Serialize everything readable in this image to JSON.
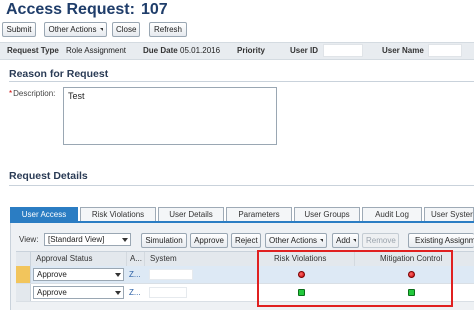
{
  "page": {
    "title_prefix": "Access Request:",
    "title_number": "107"
  },
  "toolbar": {
    "submit_label": "Submit",
    "other_actions_label": "Other Actions",
    "close_label": "Close",
    "refresh_label": "Refresh"
  },
  "header": {
    "request_type_label": "Request Type",
    "request_type_value": "Role Assignment",
    "due_date_label": "Due Date",
    "due_date_value": "05.01.2016",
    "priority_label": "Priority",
    "user_id_label": "User ID",
    "user_name_label": "User Name"
  },
  "reason": {
    "section_title": "Reason for Request",
    "description_required_mark": "*",
    "description_label": "Description:",
    "description_value": "Test"
  },
  "details": {
    "section_title": "Request Details",
    "tabs": [
      {
        "label": "User Access",
        "active": true
      },
      {
        "label": "Risk Violations",
        "active": false
      },
      {
        "label": "User Details",
        "active": false
      },
      {
        "label": "Parameters",
        "active": false
      },
      {
        "label": "User Groups",
        "active": false
      },
      {
        "label": "Audit Log",
        "active": false
      },
      {
        "label": "User Syster",
        "active": false
      }
    ],
    "view_label": "View:",
    "view_value": "[Standard View]",
    "grid_toolbar": {
      "simulation_label": "Simulation",
      "approve_label": "Approve",
      "reject_label": "Reject",
      "other_actions_label": "Other Actions",
      "add_label": "Add",
      "remove_label": "Remove",
      "existing_assignments_label": "Existing Assignme"
    },
    "columns": {
      "approval_status": "Approval Status",
      "a": "A...",
      "system": "System",
      "risk_violations": "Risk Violations",
      "mitigation_control": "Mitigation Control"
    },
    "rows": [
      {
        "approval_status": "Approve",
        "a_value": "Z...",
        "risk_status": "red",
        "mitigation_status": "red",
        "selected": true
      },
      {
        "approval_status": "Approve",
        "a_value": "Z...",
        "risk_status": "green",
        "mitigation_status": "green",
        "selected": false
      }
    ]
  },
  "colors": {
    "active_tab": "#2b7dc3",
    "highlight_box": "#e02020",
    "status_red": "#c40000",
    "status_green": "#23c93c",
    "title": "#1f3d6a"
  }
}
